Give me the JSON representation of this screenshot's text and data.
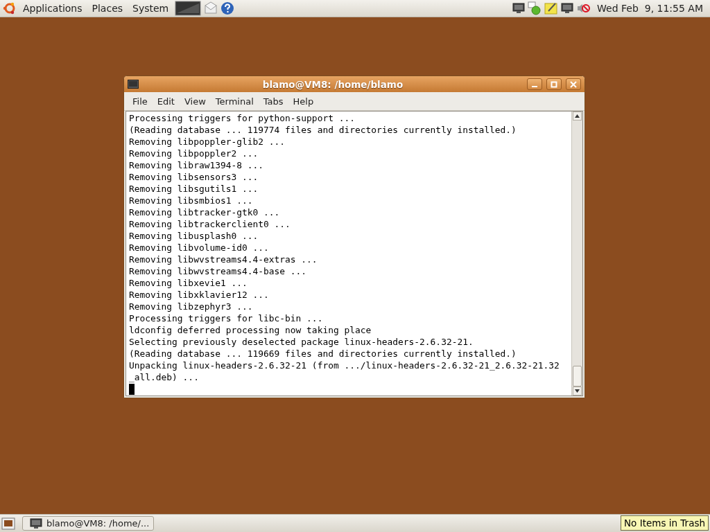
{
  "top_panel": {
    "menus": [
      "Applications",
      "Places",
      "System"
    ],
    "clock": "Wed Feb  9, 11:55 AM"
  },
  "window": {
    "title": "blamo@VM8: /home/blamo",
    "menu": [
      "File",
      "Edit",
      "View",
      "Terminal",
      "Tabs",
      "Help"
    ],
    "terminal_lines": [
      "Processing triggers for python-support ...",
      "(Reading database ... 119774 files and directories currently installed.)",
      "Removing libpoppler-glib2 ...",
      "Removing libpoppler2 ...",
      "Removing libraw1394-8 ...",
      "Removing libsensors3 ...",
      "Removing libsgutils1 ...",
      "Removing libsmbios1 ...",
      "Removing libtracker-gtk0 ...",
      "Removing libtrackerclient0 ...",
      "Removing libusplash0 ...",
      "Removing libvolume-id0 ...",
      "Removing libwvstreams4.4-extras ...",
      "Removing libwvstreams4.4-base ...",
      "Removing libxevie1 ...",
      "Removing libxklavier12 ...",
      "Removing libzephyr3 ...",
      "Processing triggers for libc-bin ...",
      "ldconfig deferred processing now taking place",
      "Selecting previously deselected package linux-headers-2.6.32-21.",
      "(Reading database ... 119669 files and directories currently installed.)",
      "Unpacking linux-headers-2.6.32-21 (from .../linux-headers-2.6.32-21_2.6.32-21.32",
      "_all.deb) ..."
    ]
  },
  "bottom_panel": {
    "taskbar": [
      {
        "label": "blamo@VM8: /home/...",
        "selected": false
      }
    ],
    "tooltip": "No Items in Trash"
  }
}
